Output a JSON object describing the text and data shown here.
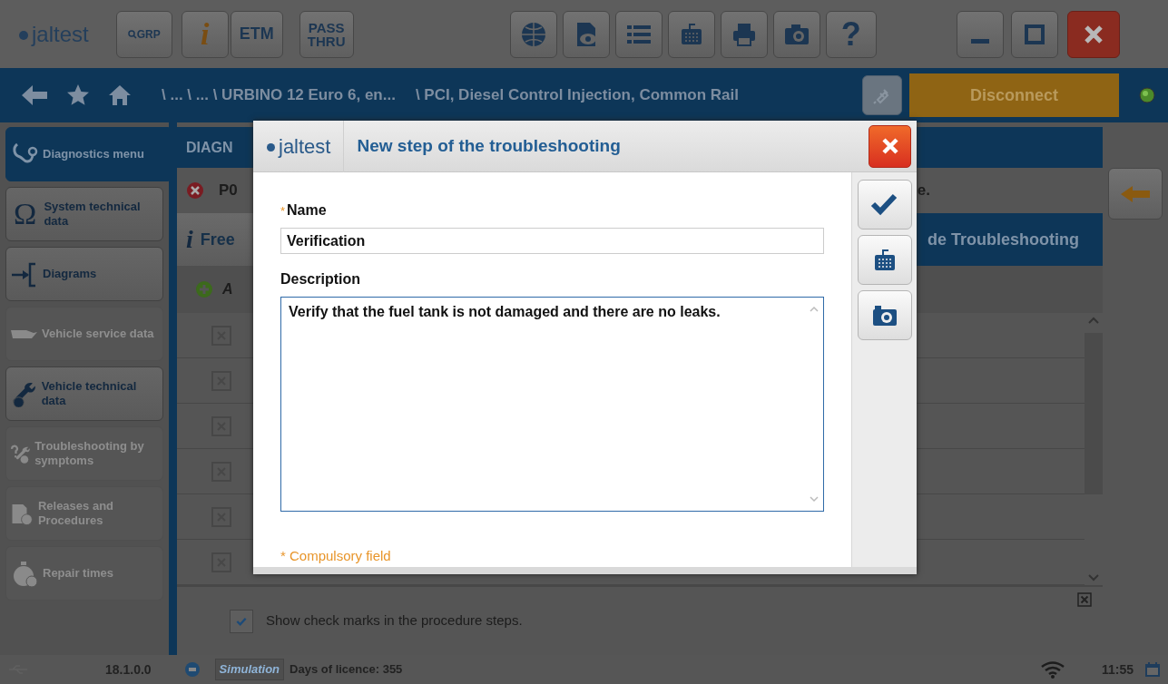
{
  "topbar": {
    "logo": "jaltest",
    "grp_label": "GRP",
    "info_glyph": "i",
    "etm_label": "ETM",
    "passthru_label": "PASS THRU",
    "help_glyph": "?"
  },
  "breadcrumb": {
    "path": "\\ ... \\ ... \\ URBINO 12 Euro 6, en...",
    "section": "\\ PCI, Diesel Control Injection, Common Rail",
    "connect_button": "Disconnect",
    "connected": true
  },
  "sidebar": {
    "items": [
      {
        "label": "Diagnostics menu",
        "kind": "stethoscope",
        "selected": true,
        "disabled": false
      },
      {
        "label": "System technical data",
        "glyph": "Ω",
        "selected": false,
        "disabled": false
      },
      {
        "label": "Diagrams",
        "kind": "diagram",
        "selected": false,
        "disabled": false
      },
      {
        "label": "Vehicle service data",
        "kind": "oilcan",
        "selected": false,
        "disabled": true
      },
      {
        "label": "Vehicle technical data",
        "kind": "wrench",
        "selected": false,
        "disabled": false
      },
      {
        "label": "Troubleshooting by symptoms",
        "kind": "question-wrench",
        "selected": false,
        "disabled": true
      },
      {
        "label": "Releases and Procedures",
        "kind": "document",
        "selected": false,
        "disabled": true
      },
      {
        "label": "Repair times",
        "kind": "stopwatch",
        "selected": false,
        "disabled": true
      }
    ]
  },
  "main": {
    "header": "DIAGN",
    "fault_code": "P0",
    "fault_tail": "e.",
    "info_glyph": "i",
    "tabs": [
      {
        "label": "Free",
        "selected": false
      },
      {
        "label": "de Troubleshooting",
        "selected": true
      }
    ],
    "add_label": "A",
    "rows": [
      {
        "kind": "x-box"
      },
      {
        "kind": "x-box"
      },
      {
        "kind": "x-box"
      },
      {
        "kind": "x-box"
      },
      {
        "kind": "x-box"
      },
      {
        "kind": "x-box"
      }
    ],
    "check_marks": {
      "label": "Show check marks in the procedure steps.",
      "checked": true
    }
  },
  "status_bar": {
    "version": "18.1.0.0",
    "mode": "Simulation",
    "licence": "Days of licence: 355",
    "time": "11:55"
  },
  "dialog": {
    "logo": "jaltest",
    "title": "New step of the troubleshooting",
    "fields": [
      {
        "kind": "input",
        "label": "Name",
        "required": true,
        "required_mark": "*",
        "value": "Verification"
      },
      {
        "kind": "textarea",
        "label": "Description",
        "required": false,
        "value": "Verify that the fuel tank is not damaged and there are no leaks."
      }
    ],
    "note": "* Compulsory field"
  }
}
